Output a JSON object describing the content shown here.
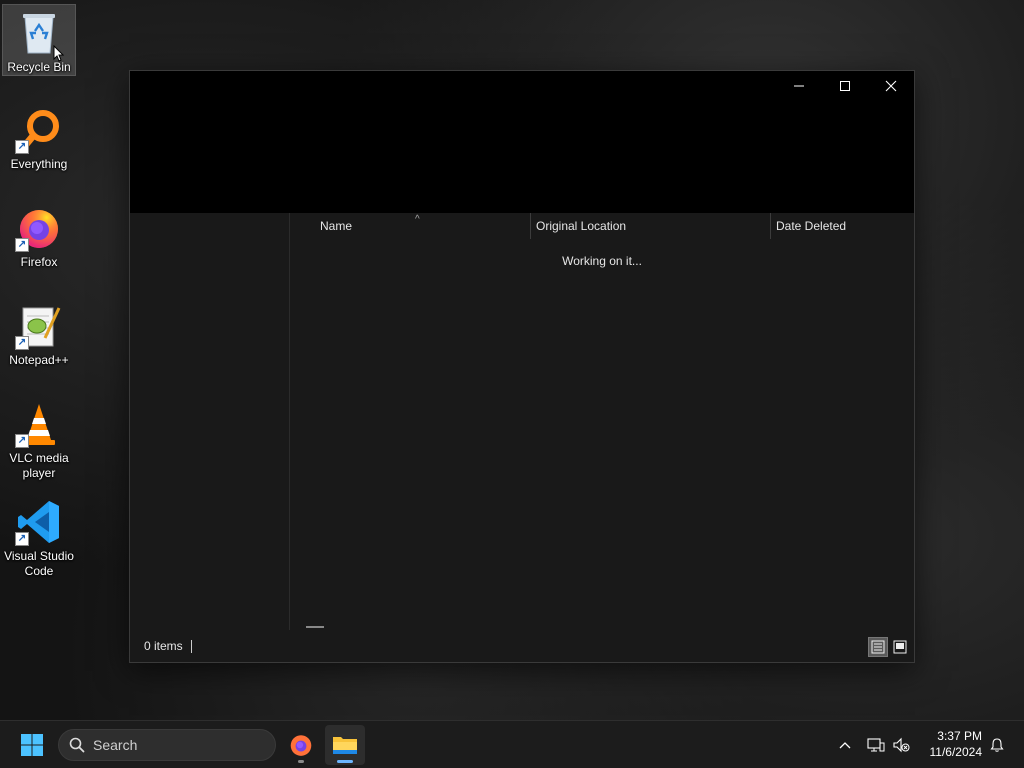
{
  "desktop": {
    "icons": [
      {
        "label": "Recycle Bin"
      },
      {
        "label": "Everything"
      },
      {
        "label": "Firefox"
      },
      {
        "label": "Notepad++"
      },
      {
        "label": "VLC media player"
      },
      {
        "label": "Visual Studio Code"
      }
    ]
  },
  "window": {
    "controls": {
      "minimize": "—",
      "maximize": "☐",
      "close": "✕"
    },
    "columns": [
      "Name",
      "Original Location",
      "Date Deleted"
    ],
    "sort_column": "Name",
    "loading_text": "Working on it...",
    "status": {
      "item_count": "0 items"
    }
  },
  "taskbar": {
    "search_label": "Search",
    "clock": {
      "time": "3:37 PM",
      "date": "11/6/2024"
    },
    "apps": [
      {
        "name": "Firefox",
        "active": false
      },
      {
        "name": "File Explorer",
        "active": true
      }
    ]
  },
  "colors": {
    "accent": "#0078d4",
    "taskbar_indicator": "#6cb6ff",
    "window_bg": "#191919",
    "titlebar_bg": "#000000"
  }
}
